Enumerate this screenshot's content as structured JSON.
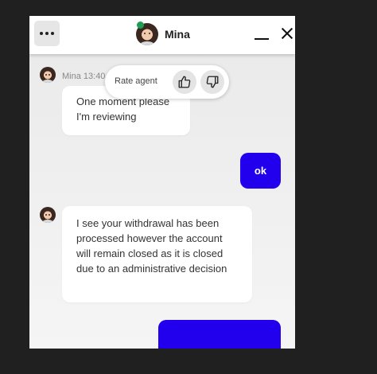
{
  "header": {
    "agent_name": "Mina",
    "online": true,
    "status_color": "#1f9d55"
  },
  "messages": [
    {
      "sender": "agent",
      "meta": "Mina 13:40",
      "text": "One moment please\nI'm reviewing"
    },
    {
      "sender": "user",
      "text": "ok"
    },
    {
      "sender": "agent",
      "text": "I see your withdrawal has been processed however the account will remain closed as it is closed due to an administrative decision"
    },
    {
      "sender": "user",
      "text": ""
    }
  ],
  "rating": {
    "label": "Rate agent",
    "up_icon": "thumbs-up-icon",
    "down_icon": "thumbs-down-icon"
  },
  "colors": {
    "user_bubble": "#2200ee",
    "page_background": "#202020",
    "chat_background": "#efefef"
  }
}
